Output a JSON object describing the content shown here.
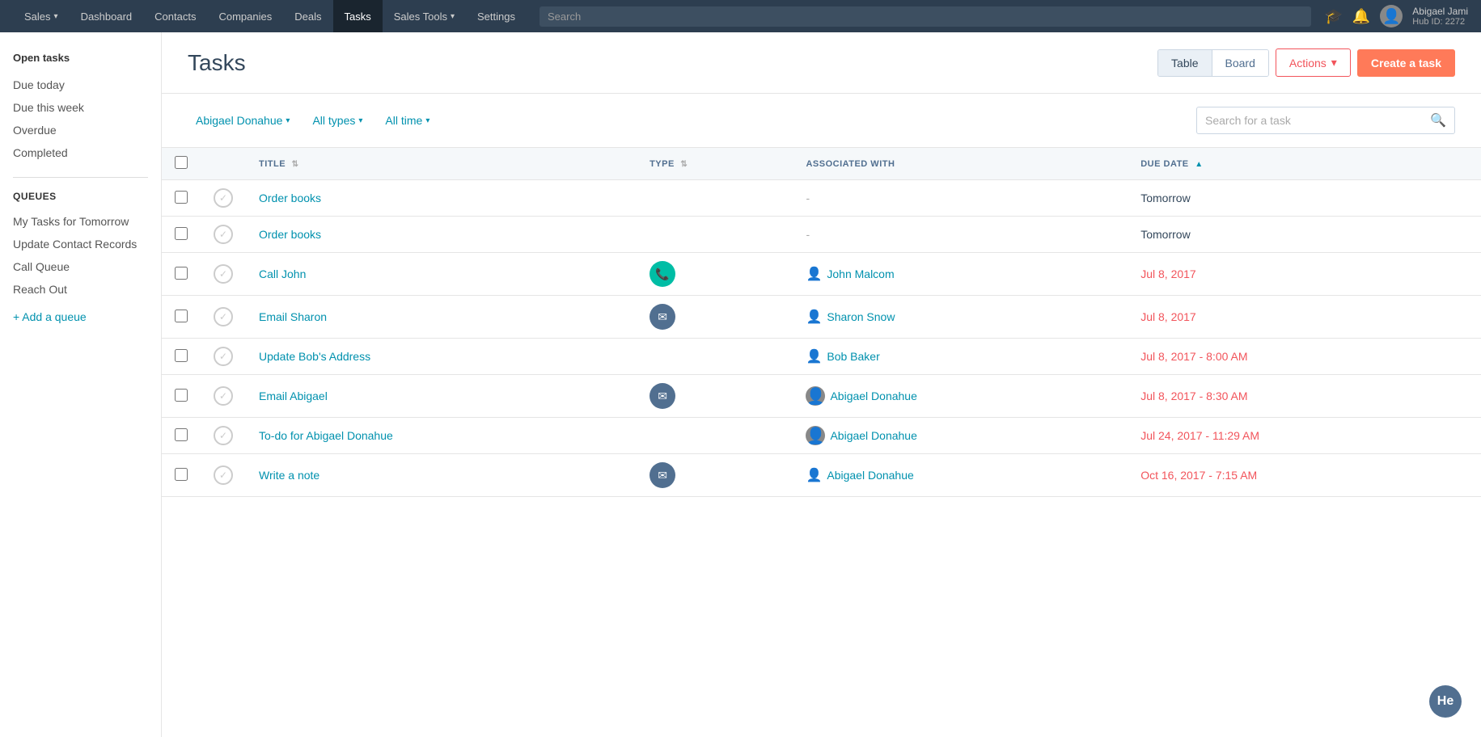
{
  "topNav": {
    "items": [
      {
        "label": "Sales",
        "hasCaret": true,
        "active": false
      },
      {
        "label": "Dashboard",
        "hasCaret": false,
        "active": false
      },
      {
        "label": "Contacts",
        "hasCaret": false,
        "active": false
      },
      {
        "label": "Companies",
        "hasCaret": false,
        "active": false
      },
      {
        "label": "Deals",
        "hasCaret": false,
        "active": false
      },
      {
        "label": "Tasks",
        "hasCaret": false,
        "active": true
      },
      {
        "label": "Sales Tools",
        "hasCaret": true,
        "active": false
      },
      {
        "label": "Settings",
        "hasCaret": false,
        "active": false
      }
    ],
    "searchPlaceholder": "Search",
    "userLabel": "Abigael Jami",
    "hubId": "Hub ID: 2272"
  },
  "sidebar": {
    "openTasksTitle": "Open tasks",
    "navLinks": [
      {
        "label": "Due today"
      },
      {
        "label": "Due this week"
      },
      {
        "label": "Overdue"
      },
      {
        "label": "Completed"
      }
    ],
    "queuesTitle": "QUEUES",
    "queues": [
      {
        "label": "My Tasks for Tomorrow"
      },
      {
        "label": "Update Contact Records"
      },
      {
        "label": "Call Queue"
      },
      {
        "label": "Reach Out"
      }
    ],
    "addQueueLabel": "+ Add a queue"
  },
  "header": {
    "title": "Tasks",
    "viewButtons": [
      {
        "label": "Table",
        "active": true
      },
      {
        "label": "Board",
        "active": false
      }
    ],
    "actionsLabel": "Actions",
    "createLabel": "Create a task"
  },
  "filters": {
    "assignee": "Abigael Donahue",
    "type": "All types",
    "time": "All time",
    "searchPlaceholder": "Search for a task"
  },
  "table": {
    "columns": [
      {
        "label": "TITLE",
        "sortable": true,
        "sortDir": ""
      },
      {
        "label": "TYPE",
        "sortable": true,
        "sortDir": ""
      },
      {
        "label": "ASSOCIATED WITH",
        "sortable": false
      },
      {
        "label": "DUE DATE",
        "sortable": true,
        "sortDir": "asc"
      }
    ],
    "rows": [
      {
        "title": "Order books",
        "type": "",
        "typeIcon": "",
        "associated": "-",
        "associatedLink": false,
        "hasAvatar": false,
        "dueDate": "Tomorrow",
        "overdue": false
      },
      {
        "title": "Order books",
        "type": "",
        "typeIcon": "",
        "associated": "-",
        "associatedLink": false,
        "hasAvatar": false,
        "dueDate": "Tomorrow",
        "overdue": false
      },
      {
        "title": "Call John",
        "type": "call",
        "typeIcon": "📞",
        "associated": "John Malcom",
        "associatedLink": true,
        "hasAvatar": false,
        "dueDate": "Jul 8, 2017",
        "overdue": true
      },
      {
        "title": "Email Sharon",
        "type": "email",
        "typeIcon": "✉",
        "associated": "Sharon Snow",
        "associatedLink": true,
        "hasAvatar": false,
        "dueDate": "Jul 8, 2017",
        "overdue": true
      },
      {
        "title": "Update Bob's Address",
        "type": "",
        "typeIcon": "",
        "associated": "Bob Baker",
        "associatedLink": true,
        "hasAvatar": false,
        "dueDate": "Jul 8, 2017 - 8:00 AM",
        "overdue": true
      },
      {
        "title": "Email Abigael",
        "type": "email",
        "typeIcon": "✉",
        "associated": "Abigael Donahue",
        "associatedLink": true,
        "hasAvatar": true,
        "dueDate": "Jul 8, 2017 - 8:30 AM",
        "overdue": true
      },
      {
        "title": "To-do for Abigael Donahue",
        "type": "",
        "typeIcon": "",
        "associated": "Abigael Donahue",
        "associatedLink": true,
        "hasAvatar": true,
        "dueDate": "Jul 24, 2017 - 11:29 AM",
        "overdue": true
      },
      {
        "title": "Write a note",
        "type": "email",
        "typeIcon": "✉",
        "associated": "Abigael Donahue",
        "associatedLink": true,
        "hasAvatar": false,
        "dueDate": "Oct 16, 2017 - 7:15 AM",
        "overdue": true
      }
    ]
  },
  "helpButton": "He"
}
